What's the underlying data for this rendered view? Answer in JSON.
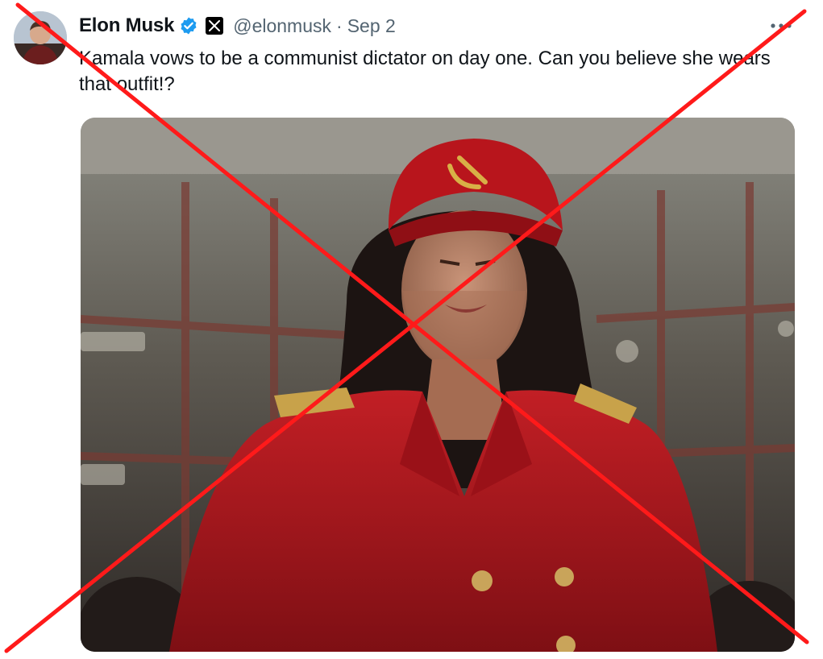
{
  "author": {
    "name": "Elon Musk",
    "handle": "@elonmusk",
    "separator": "·",
    "date": "Sep 2",
    "verified_color": "#1d9bf0"
  },
  "tweet": {
    "text": "Kamala vows to be a communist dictator on day one. Can you believe she wears that outfit!?"
  },
  "icons": {
    "avatar": "profile-photo",
    "verified": "verified-badge-icon",
    "affiliate": "x-logo-icon",
    "more": "more-options-icon",
    "overlay": "red-x-cross-icon"
  },
  "colors": {
    "cross": "#ff1a1a",
    "coat": "#b3171f"
  }
}
